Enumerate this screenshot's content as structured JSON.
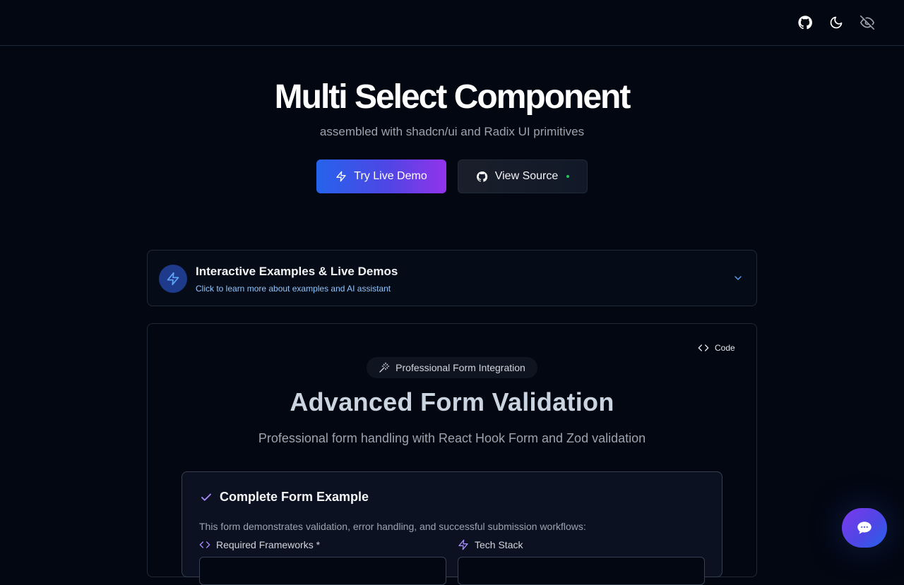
{
  "header": {
    "icons": [
      "github-icon",
      "moon-icon",
      "eye-off-icon"
    ]
  },
  "hero": {
    "title": "Multi Select Component",
    "subtitle": "assembled with shadcn/ui and Radix UI primitives",
    "demo_button": "Try Live Demo",
    "source_button": "View Source"
  },
  "accordion": {
    "title": "Interactive Examples & Live Demos",
    "subtitle": "Click to learn more about examples and AI assistant"
  },
  "example": {
    "code_button": "Code",
    "badge": "Professional Form Integration",
    "title": "Advanced Form Validation",
    "subtitle": "Professional form handling with React Hook Form and Zod validation",
    "form": {
      "title": "Complete Form Example",
      "description": "This form demonstrates validation, error handling, and successful submission workflows:",
      "fields": [
        {
          "label": "Required Frameworks *",
          "icon": "code-icon"
        },
        {
          "label": "Tech Stack",
          "icon": "zap-icon"
        }
      ]
    }
  },
  "colors": {
    "background": "#030712",
    "accent_blue": "#2563eb",
    "accent_purple": "#9333ea",
    "status_green": "#22c55e"
  }
}
